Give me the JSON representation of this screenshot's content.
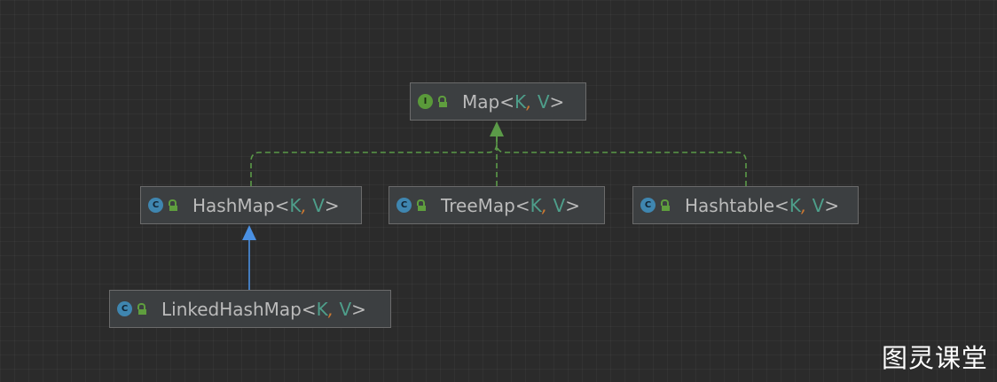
{
  "diagram": {
    "nodes": [
      {
        "id": "map",
        "kind": "interface",
        "kind_letter": "I",
        "name": "Map",
        "lt": "<",
        "param_k": "K",
        "comma": ",",
        "param_v": "V",
        "gt": ">"
      },
      {
        "id": "hashmap",
        "kind": "class",
        "kind_letter": "C",
        "name": "HashMap",
        "lt": "<",
        "param_k": "K",
        "comma": ",",
        "param_v": "V",
        "gt": ">"
      },
      {
        "id": "treemap",
        "kind": "class",
        "kind_letter": "C",
        "name": "TreeMap",
        "lt": "<",
        "param_k": "K",
        "comma": ",",
        "param_v": "V",
        "gt": ">"
      },
      {
        "id": "hashtable",
        "kind": "class",
        "kind_letter": "C",
        "name": "Hashtable",
        "lt": "<",
        "param_k": "K",
        "comma": ",",
        "param_v": "V",
        "gt": ">"
      },
      {
        "id": "linkedhashmap",
        "kind": "class",
        "kind_letter": "C",
        "name": "LinkedHashMap",
        "lt": "<",
        "param_k": "K",
        "comma": ",",
        "param_v": "V",
        "gt": ">"
      }
    ],
    "edges": [
      {
        "from": "hashmap",
        "to": "map",
        "type": "implements"
      },
      {
        "from": "treemap",
        "to": "map",
        "type": "implements"
      },
      {
        "from": "hashtable",
        "to": "map",
        "type": "implements"
      },
      {
        "from": "linkedhashmap",
        "to": "hashmap",
        "type": "extends"
      }
    ],
    "colors": {
      "implements_edge": "#5b9a48",
      "extends_edge": "#4a90e2",
      "interface_badge": "#5a9a3a",
      "class_badge": "#3f86b0",
      "type_param": "#4e9e8a",
      "comma": "#cc7832"
    },
    "icons": {
      "interface": "interface-icon",
      "class": "class-icon",
      "visibility": "unlocked-icon"
    }
  },
  "watermark": "图灵课堂"
}
